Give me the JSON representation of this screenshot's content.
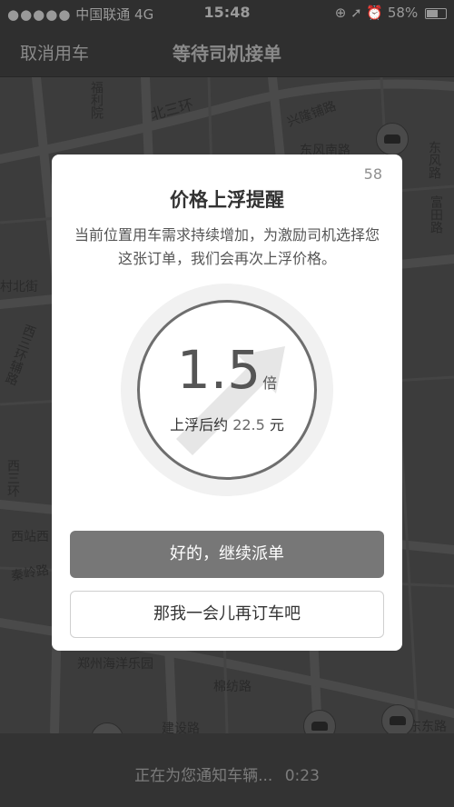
{
  "status_bar": {
    "signal": "●●●●●",
    "carrier": "中国联通",
    "network": "4G",
    "time": "15:48",
    "icons": "⊕ ➚ ⏰",
    "battery": "58%"
  },
  "nav": {
    "cancel": "取消用车",
    "title": "等待司机接单"
  },
  "map": {
    "labels": {
      "l1": "福利院",
      "l2": "北三环",
      "l3": "兴隆铺路",
      "l4": "富田路",
      "l5": "东风路",
      "l6": "东风南路",
      "l7": "村北街",
      "l8": "西三环辅路",
      "l9": "西三环",
      "l10": "西站西",
      "l11": "秦岭路",
      "l12": "郑州海洋乐园",
      "l13": "棉纺路",
      "l14": "建设路",
      "l15": "东东路"
    }
  },
  "dialog": {
    "countdown": "58",
    "title": "价格上浮提醒",
    "description": "当前位置用车需求持续增加，为激励司机选择您这张订单，我们会再次上浮价格。",
    "multiplier": "1.5",
    "multiplier_unit": "倍",
    "estimate_prefix": "上浮后约",
    "estimate_amount": "22.5",
    "estimate_unit": "元",
    "confirm_label": "好的，继续派单",
    "decline_label": "那我一会儿再订车吧"
  },
  "bottom": {
    "message": "正在为您通知车辆...",
    "timer": "0:23"
  },
  "colors": {
    "primary_button": "#777777",
    "dim_overlay": "#3a3a3a"
  }
}
